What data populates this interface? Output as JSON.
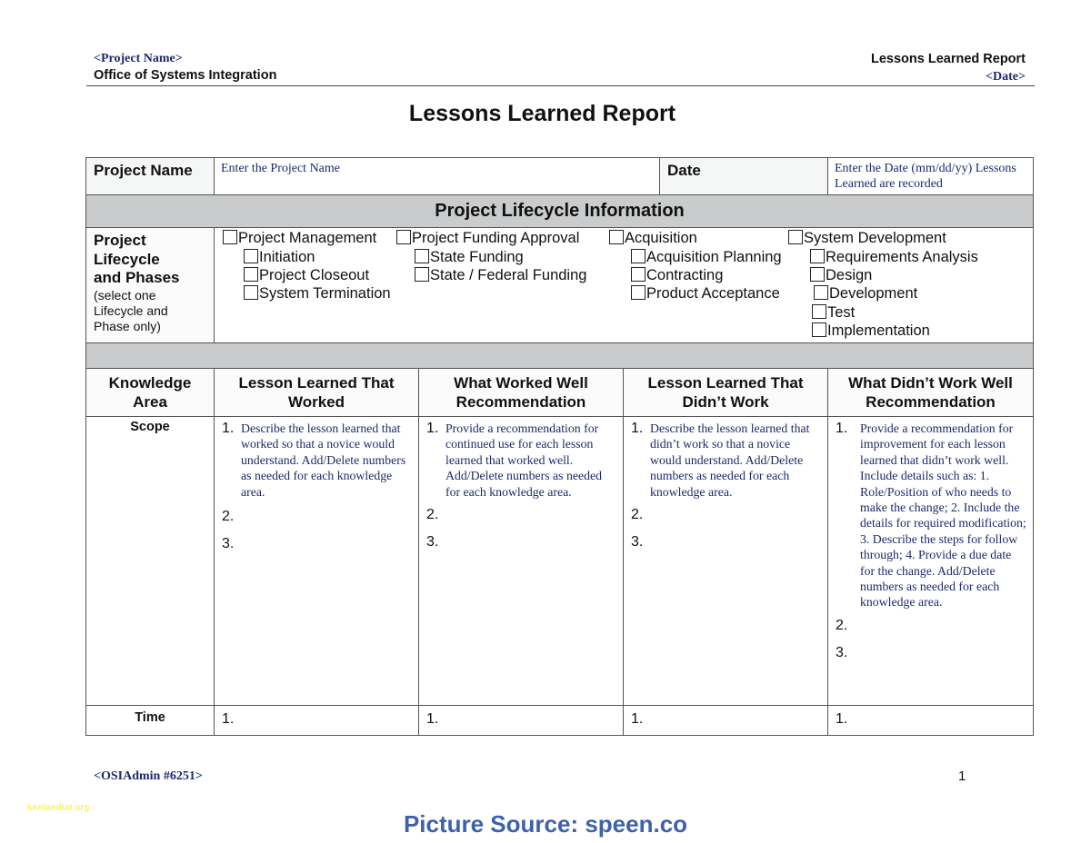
{
  "header": {
    "project_name": "<Project Name>",
    "office": "Office of Systems Integration",
    "report_name": "Lessons Learned Report",
    "date": "<Date>"
  },
  "title": "Lessons Learned Report",
  "form": {
    "project_name_label": "Project Name",
    "project_name_placeholder": "Enter the Project Name",
    "date_label": "Date",
    "date_placeholder": "Enter the Date (mm/dd/yy) Lessons Learned are recorded",
    "section_title": "Project Lifecycle Information",
    "lifecycle_label_lines": [
      "Project",
      "Lifecycle",
      "and Phases"
    ],
    "lifecycle_note_lines": [
      "(select one",
      "Lifecycle and",
      "Phase only)"
    ],
    "checkboxes": [
      {
        "label": "Project Management",
        "checked": false
      },
      {
        "label": "Initiation",
        "checked": false
      },
      {
        "label": "Project Closeout",
        "checked": false
      },
      {
        "label": "System Termination",
        "checked": false
      },
      {
        "label": "Project Funding Approval",
        "checked": false
      },
      {
        "label": "State Funding",
        "checked": false
      },
      {
        "label": "State / Federal Funding",
        "checked": false
      },
      {
        "label": "Acquisition",
        "checked": false
      },
      {
        "label": "Acquisition Planning",
        "checked": false
      },
      {
        "label": "Contracting",
        "checked": false
      },
      {
        "label": "Product Acceptance",
        "checked": false
      },
      {
        "label": "System Development",
        "checked": false
      },
      {
        "label": "Requirements Analysis",
        "checked": false
      },
      {
        "label": "Design",
        "checked": false
      },
      {
        "label": "Development",
        "checked": false
      },
      {
        "label": "Test",
        "checked": false
      },
      {
        "label": "Implementation",
        "checked": false
      }
    ],
    "columns": [
      "Knowledge Area",
      "Lesson Learned That Worked",
      "What Worked Well Recommendation",
      "Lesson Learned That Didn’t Work",
      "What Didn’t Work Well Recommendation"
    ],
    "rows": [
      {
        "area": "Scope",
        "cells": [
          {
            "numbers": [
              "1.",
              "2.",
              "3."
            ],
            "text": "Describe the lesson learned that worked so that a novice would understand. Add/Delete numbers as needed for each knowledge area."
          },
          {
            "numbers": [
              "1.",
              "2.",
              "3."
            ],
            "text": "Provide a recommendation for continued use for each lesson learned that worked well. Add/Delete numbers as needed for each knowledge area."
          },
          {
            "numbers": [
              "1.",
              "2.",
              "3."
            ],
            "text": "Describe the lesson learned that didn’t work so that a novice would understand. Add/Delete numbers as needed for each knowledge area."
          },
          {
            "numbers": [
              "1.",
              "2.",
              "3."
            ],
            "text": "Provide a recommendation for improvement for each lesson learned that didn’t work well. Include details such as: 1. Role/Position of who needs to make the change; 2. Include the details for required modification; 3. Describe the steps for follow through; 4. Provide a due date for the change. Add/Delete numbers as needed for each knowledge area."
          }
        ]
      },
      {
        "area": "Time",
        "cells": [
          {
            "numbers": [
              "1."
            ]
          },
          {
            "numbers": [
              "1."
            ]
          },
          {
            "numbers": [
              "1."
            ]
          },
          {
            "numbers": [
              "1."
            ]
          }
        ]
      }
    ]
  },
  "footer": {
    "doc_id": "<OSIAdmin #6251>",
    "page_number": "1",
    "watermark": "kenlandlat.org",
    "picture_source": "Picture Source: speen.co"
  },
  "colors": {
    "navy_text": "#1d2a6b",
    "section_gray": "#c9cbcc",
    "picture_source_blue": "#3f62ab",
    "watermark_yellow": "#f4f36a"
  }
}
